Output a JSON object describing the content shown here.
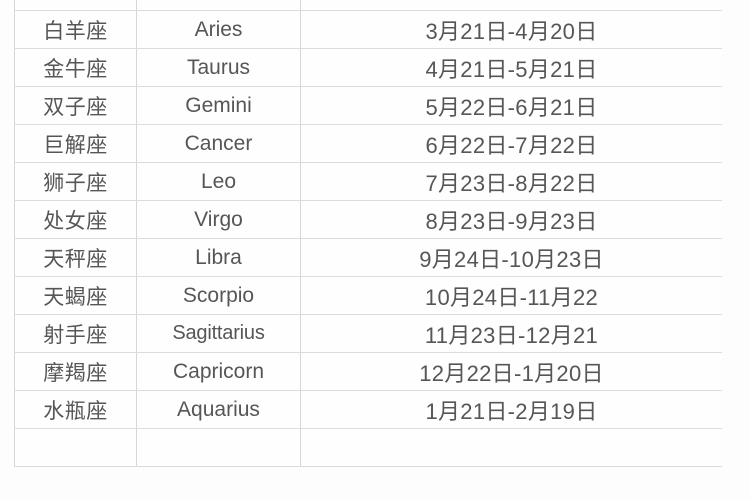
{
  "document": {
    "type": "table",
    "description": "Chinese zodiac / western astrology sign date-range table",
    "colors": {
      "page_background": "#fdfdfd",
      "cell_background": "#fefefe",
      "border": "#dcdcdc",
      "text": "#565656"
    }
  },
  "table": {
    "columns": [
      {
        "key": "chinese_name",
        "header": ""
      },
      {
        "key": "english_name",
        "header": ""
      },
      {
        "key": "date_range",
        "header": ""
      }
    ],
    "partial_top_row": {
      "chinese_name": "",
      "english_name": "",
      "date_range": ""
    },
    "rows": [
      {
        "chinese_name": "白羊座",
        "english_name": "Aries",
        "date_range": "3月21日-4月20日"
      },
      {
        "chinese_name": "金牛座",
        "english_name": "Taurus",
        "date_range": "4月21日-5月21日"
      },
      {
        "chinese_name": "双子座",
        "english_name": "Gemini",
        "date_range": "5月22日-6月21日"
      },
      {
        "chinese_name": "巨解座",
        "english_name": "Cancer",
        "date_range": "6月22日-7月22日"
      },
      {
        "chinese_name": "狮子座",
        "english_name": "Leo",
        "date_range": "7月23日-8月22日"
      },
      {
        "chinese_name": "处女座",
        "english_name": "Virgo",
        "date_range": "8月23日-9月23日"
      },
      {
        "chinese_name": "天秤座",
        "english_name": "Libra",
        "date_range": "9月24日-10月23日"
      },
      {
        "chinese_name": "天蝎座",
        "english_name": "Scorpio",
        "date_range": "10月24日-11月22"
      },
      {
        "chinese_name": "射手座",
        "english_name": "Sagittarius",
        "date_range": "11月23日-12月21"
      },
      {
        "chinese_name": "摩羯座",
        "english_name": "Capricorn",
        "date_range": "12月22日-1月20日"
      },
      {
        "chinese_name": "水瓶座",
        "english_name": "Aquarius",
        "date_range": "1月21日-2月19日"
      }
    ],
    "partial_bottom_row": {
      "chinese_name": "",
      "english_name": "",
      "date_range": ""
    }
  }
}
